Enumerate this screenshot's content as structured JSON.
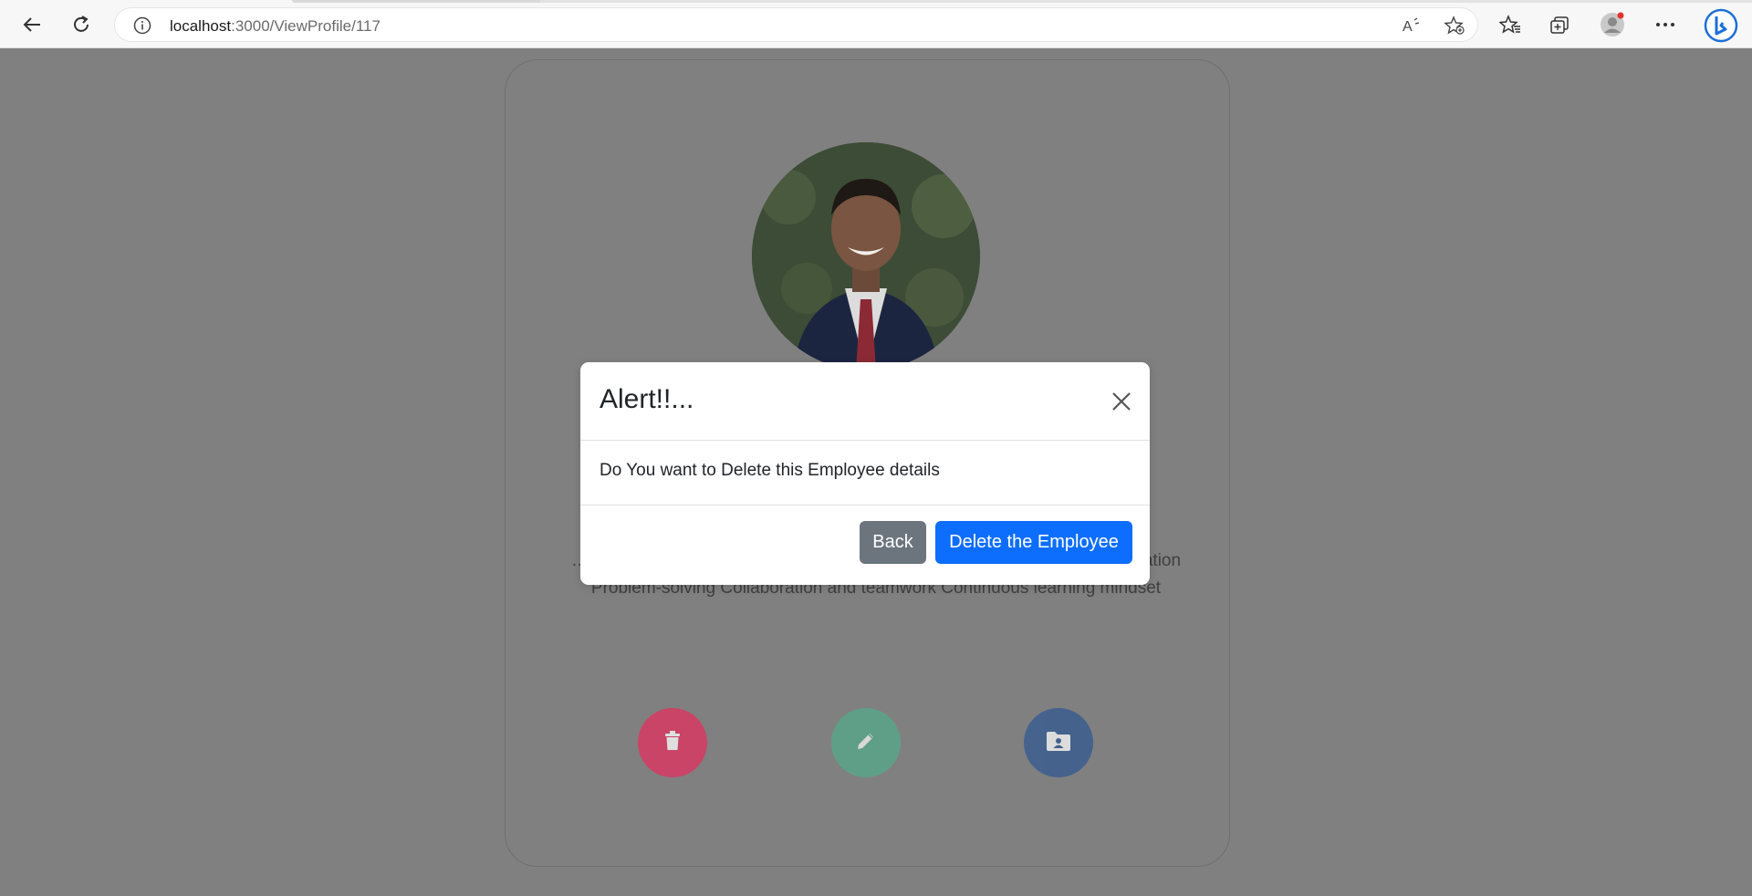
{
  "browser": {
    "url_host": "localhost",
    "url_rest": ":3000/ViewProfile/117",
    "icons": [
      "back-arrow-icon",
      "refresh-icon",
      "info-icon",
      "read-aloud-icon",
      "add-favorite-icon",
      "favorites-icon",
      "collections-icon",
      "profile-icon",
      "more-icon",
      "bing-icon"
    ]
  },
  "profile": {
    "bio": "… development tools (e.g., Git, npm, yarn, Webpack) Performance optimization Problem-solving Collaboration and teamwork Continuous learning mindset",
    "actions": [
      {
        "name": "delete",
        "icon": "trash-icon",
        "color": "#d63a62"
      },
      {
        "name": "edit",
        "icon": "pencil-icon",
        "color": "#5aa58a"
      },
      {
        "name": "view",
        "icon": "folder-user-icon",
        "color": "#3f5f8f"
      }
    ]
  },
  "modal": {
    "title": "Alert!!...",
    "body": "Do You want to Delete this Employee details",
    "back_label": "Back",
    "delete_label": "Delete the Employee"
  },
  "colors": {
    "overlay": "#808080",
    "primary": "#0d6efd",
    "secondary": "#6c757d"
  }
}
